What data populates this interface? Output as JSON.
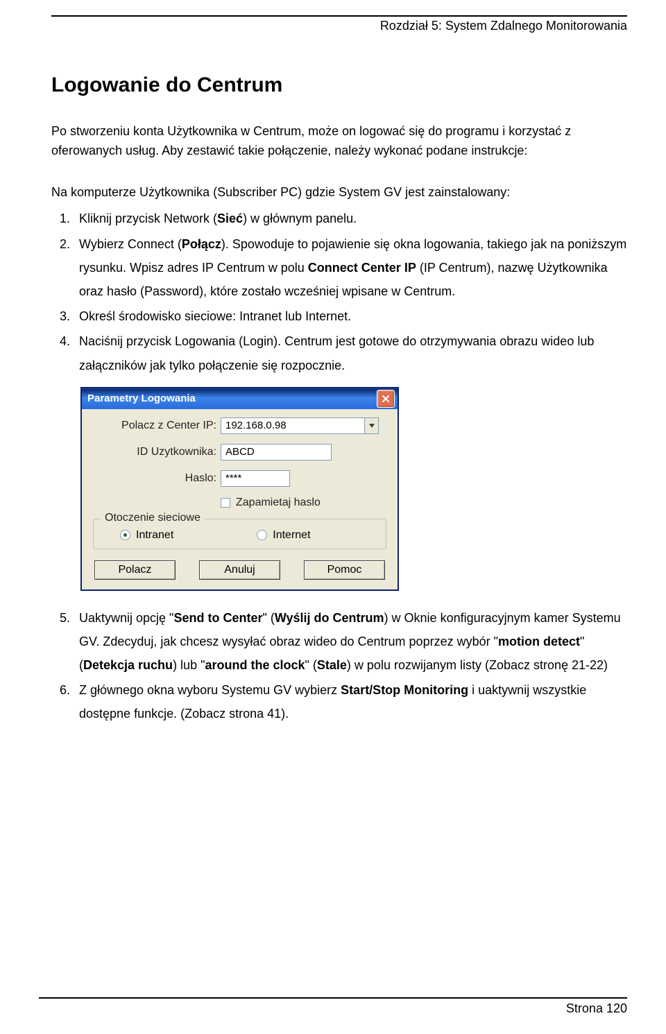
{
  "header": {
    "chapter": "Rozdział 5: System Zdalnego Monitorowania"
  },
  "title": "Logowanie do Centrum",
  "para1": "Po stworzeniu konta Użytkownika w Centrum, może on logować się do programu i korzystać z oferowanych usług. Aby zestawić takie połączenie, należy wykonać podane instrukcje:",
  "para2": "Na komputerze Użytkownika (Subscriber PC) gdzie System GV jest zainstalowany:",
  "steps": [
    {
      "pre": "Kliknij przycisk Network (",
      "b": "Sieć",
      "post": ") w głównym panelu."
    },
    {
      "pre": "Wybierz Connect (",
      "b": "Połącz",
      "post": "). Spowoduje to pojawienie się okna logowania, takiego jak na poniższym rysunku. Wpisz adres IP Centrum w polu ",
      "b2": "Connect Center IP",
      "post2": " (IP Centrum), nazwę Użytkownika oraz hasło (Password), które zostało wcześniej wpisane w Centrum."
    },
    {
      "text": "Określ środowisko sieciowe: Intranet lub Internet."
    },
    {
      "text": "Naciśnij przycisk Logowania (Login). Centrum jest gotowe do otrzymywania obrazu wideo lub załączników jak tylko połączenie się rozpocznie."
    }
  ],
  "dialog": {
    "title": "Parametry Logowania",
    "labels": {
      "ip": "Polacz z Center IP:",
      "user": "ID Uzytkownika:",
      "pass": "Haslo:"
    },
    "values": {
      "ip": "192.168.0.98",
      "user": "ABCD",
      "pass": "****"
    },
    "remember": "Zapamietaj haslo",
    "group": "Otoczenie sieciowe",
    "radios": {
      "intranet": "Intranet",
      "internet": "Internet"
    },
    "buttons": {
      "connect": "Polacz",
      "cancel": "Anuluj",
      "help": "Pomoc"
    }
  },
  "steps2": [
    {
      "pre": "Uaktywnij opcję \"",
      "b1": "Send to Center",
      "mid": "\" (",
      "b2": "Wyślij do Centrum",
      "post": ") w Oknie konfiguracyjnym kamer Systemu GV. Zdecyduj, jak chcesz wysyłać obraz wideo do Centrum poprzez wybór \"",
      "b3": "motion detect",
      "post2": "\" (",
      "b4": "Detekcja ruchu",
      "post3": ") lub \"",
      "b5": "around the clock",
      "post4": "\" (",
      "b6": "Stale",
      "post5": ") w polu rozwijanym listy (Zobacz stronę 21-22)"
    },
    {
      "pre": "Z głównego okna wyboru Systemu GV wybierz ",
      "b1": "Start/Stop Monitoring",
      "post": " i uaktywnij wszystkie dostępne funkcje. (Zobacz strona 41)."
    }
  ],
  "footer": "Strona 120"
}
